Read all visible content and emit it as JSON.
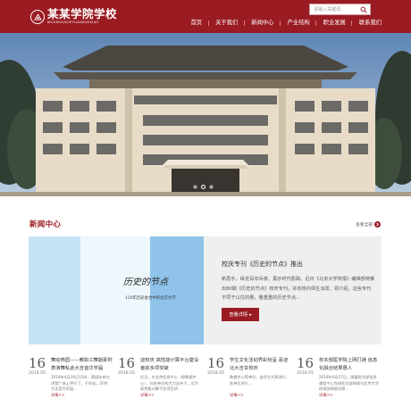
{
  "header": {
    "logo_cn": "某某学院学校",
    "logo_en": "MOUMOUXUEYUANXUEXIAO",
    "search_placeholder": "请输入关键词",
    "nav": [
      "首页",
      "关于我们",
      "新闻中心",
      "产业结构",
      "职业发展",
      "联系我们"
    ]
  },
  "banner": {
    "slides": 3,
    "active_slide": 1
  },
  "news": {
    "section_title": "新闻中心",
    "more_label": "查看全部",
    "feature": {
      "image_title": "历史的节点",
      "image_subtitle": "120年历史会合中的北京大学",
      "title": "校庆专刊《历史的节点》推出",
      "text": "新思手，纵览百年兵衰、黑示时代影踪。近日《北京大学校报》编辑部特推出80期《历史的节点》校庆专刊，并向校内师生派发、领介绍。这些专刊不同于以往的量，看重重的历史节点...",
      "button_label": "查看详情"
    },
    "items": [
      {
        "day": "16",
        "date": "2018.05",
        "headline": "舞动燕园——教职工舞蹈即时表演舞私此大吉音华学届",
        "summary": "2018年4月30日12时，燕园年有在讲堂广场上举行了。千年桂，20岁大吉音华学届...",
        "detail": "详情>>"
      },
      {
        "day": "16",
        "date": "2018.05",
        "headline": "迎校庆 高性能计算平台建设者获多项突破",
        "summary": "近日，在北京信息中心（原数据中心），在各单位的大力支持下，北大高性能计算平台项目研...",
        "detail": "详情>>"
      },
      {
        "day": "16",
        "date": "2018.05",
        "headline": "学生文化活动界彩纷呈 喜迎北大吉甘校庆",
        "summary": "数据中心等单位，由学生代表进行，各单位进行...",
        "detail": "详情>>"
      },
      {
        "day": "16",
        "date": "2018.05",
        "headline": "校本部医学院上网打通 信息化融合结果惠人",
        "summary": "2018年4月27日，随着医学部信息通信中心完成医学部网络与北京大学校本部网络对接...",
        "detail": "详情>>"
      }
    ]
  },
  "colors": {
    "brand": "#9a1b22",
    "panel": "#efefef",
    "image_blue": "#8fc3ea"
  }
}
